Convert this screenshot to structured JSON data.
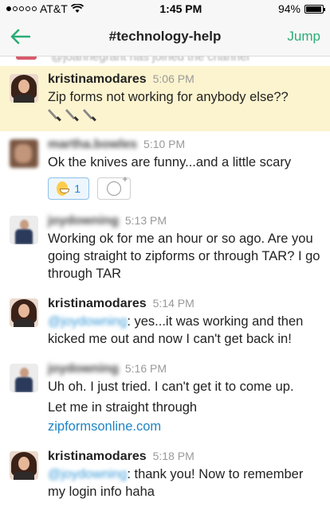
{
  "status_bar": {
    "carrier": "AT&T",
    "time": "1:45 PM",
    "battery": "94%"
  },
  "header": {
    "back_icon": "arrow-left-icon",
    "title": "#technology-help",
    "jump_label": "Jump"
  },
  "system_line": {
    "text": "@joannegrant has joined the channel"
  },
  "messages": [
    {
      "author": "kristinamodares",
      "time": "5:06 PM",
      "text": "Zip forms not working for anybody else??",
      "extra": "🔪🔪🔪"
    },
    {
      "author": "martha.bowles",
      "time": "5:10 PM",
      "text": "Ok the knives are funny...and a little scary",
      "reaction_count": "1"
    },
    {
      "author": "joydowning",
      "time": "5:13 PM",
      "text": "Working ok for me an hour or so ago. Are you going straight to zipforms or through TAR? I go through TAR"
    },
    {
      "author": "kristinamodares",
      "time": "5:14 PM",
      "mention": "@joydowning",
      "text": ": yes...it was working and then kicked me out and now I can't get back in!"
    },
    {
      "author": "joydowning",
      "time": "5:16 PM",
      "text": "Uh oh. I just tried. I can't get it to come up.",
      "text2": "Let me in straight through",
      "link": "zipformsonline.com"
    },
    {
      "author": "kristinamodares",
      "time": "5:18 PM",
      "mention": "@joydowning",
      "text": ": thank you! Now to remember my login info haha"
    }
  ]
}
